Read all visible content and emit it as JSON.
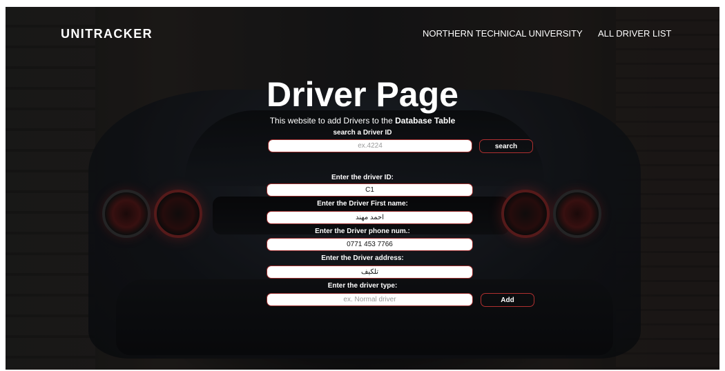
{
  "nav": {
    "brand": "UNITRACKER",
    "links": [
      "NORTHERN TECHNICAL UNIVERSITY",
      "ALL DRIVER LIST"
    ]
  },
  "hero": {
    "title": "Driver Page",
    "subtitle_prefix": "This website to add Drivers to the ",
    "subtitle_emphasis": "Database Table"
  },
  "search": {
    "label": "search a Driver ID",
    "placeholder": "ex.4224",
    "value": "",
    "button": "search"
  },
  "form": {
    "driver_id": {
      "label": "Enter the driver ID:",
      "value": "C1"
    },
    "first_name": {
      "label": "Enter the Driver First name:",
      "value": "احمد مهند"
    },
    "phone": {
      "label": "Enter the Driver phone num.:",
      "value": "0771 453 7766"
    },
    "address": {
      "label": "Enter the Driver address:",
      "value": "تلكيف"
    },
    "driver_type": {
      "label": "Enter the driver type:",
      "placeholder": "ex. Normal driver",
      "value": ""
    },
    "add_button": "Add"
  },
  "colors": {
    "accent_border": "#b03030",
    "text": "#ffffff",
    "field_bg": "#ffffff"
  }
}
